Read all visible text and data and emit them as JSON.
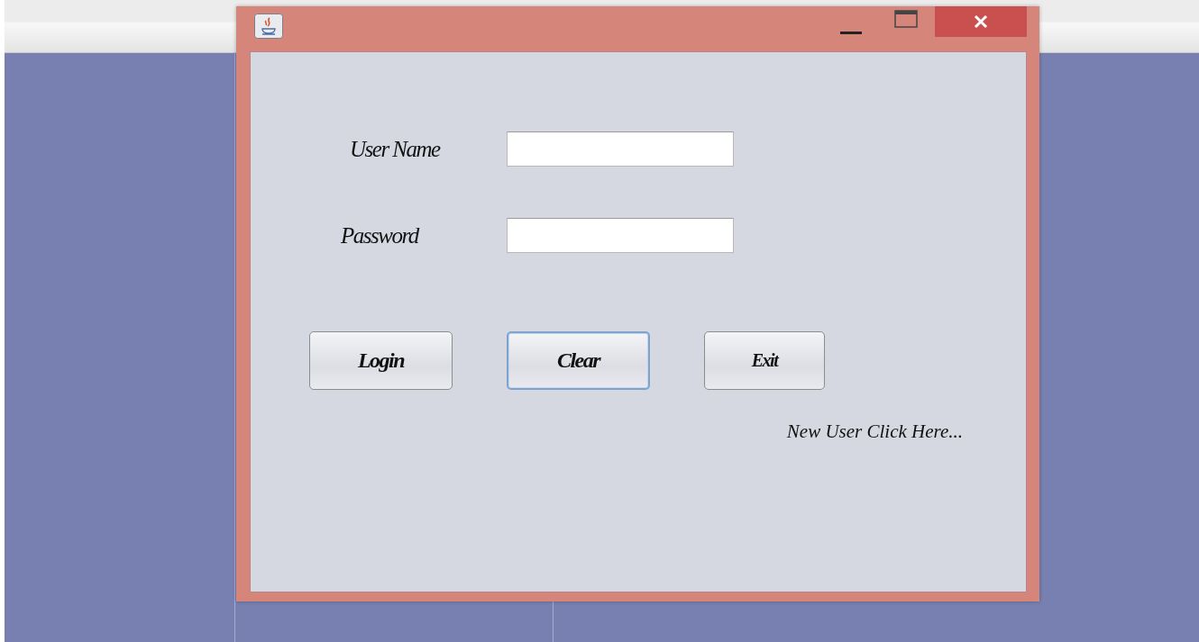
{
  "form": {
    "fields": [
      {
        "label": "User Name"
      },
      {
        "label": "Password"
      }
    ],
    "buttons": [
      {
        "label": "Login",
        "focused": false
      },
      {
        "label": "Clear",
        "focused": true
      },
      {
        "label": "Exit",
        "focused": false
      }
    ],
    "link": "New User Click Here..."
  }
}
